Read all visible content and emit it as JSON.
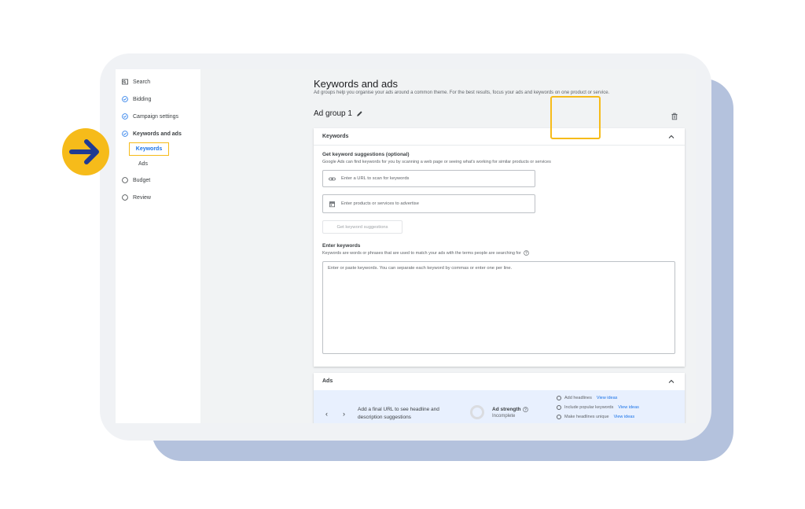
{
  "sidebar": {
    "items": [
      {
        "label": "Search",
        "icon": "search-box-icon"
      },
      {
        "label": "Bidding",
        "icon": "check-circle-icon"
      },
      {
        "label": "Campaign settings",
        "icon": "check-circle-icon"
      },
      {
        "label": "Keywords and ads",
        "icon": "check-circle-icon"
      },
      {
        "label": "Budget",
        "icon": "empty-circle-icon"
      },
      {
        "label": "Review",
        "icon": "empty-circle-icon"
      }
    ],
    "sub_items": [
      {
        "label": "Keywords",
        "active": true
      },
      {
        "label": "Ads",
        "active": false
      }
    ]
  },
  "main": {
    "title": "Keywords and ads",
    "description": "Ad groups help you organise your ads around a common theme. For the best results, focus your ads and keywords on one product or service.",
    "ad_group_name": "Ad group 1"
  },
  "keywords_panel": {
    "header": "Keywords",
    "suggestions_title": "Get keyword suggestions (optional)",
    "suggestions_desc": "Google Ads can find keywords for you by scanning a web page or seeing what's working for similar products or services",
    "url_placeholder": "Enter a URL to scan for keywords",
    "products_placeholder": "Enter products or services to advertise",
    "get_suggestions_button": "Get keyword suggestions",
    "enter_title": "Enter keywords",
    "enter_desc": "Keywords are words or phrases that are used to match your ads with the terms people are searching for",
    "textarea_placeholder": "Enter or paste keywords. You can separate each keyword by commas or enter one per line."
  },
  "ads_panel": {
    "header": "Ads",
    "suggestion_text": "Add a final URL to see headline and description suggestions",
    "strength_label": "Ad strength",
    "strength_status": "Incomplete",
    "checklist": [
      {
        "label": "Add headlines",
        "link": "View ideas"
      },
      {
        "label": "Include popular keywords",
        "link": "View ideas"
      },
      {
        "label": "Make headlines unique",
        "link": "View ideas"
      }
    ]
  },
  "colors": {
    "accent": "#1a73e8",
    "highlight": "#f6bb1a",
    "arrow": "#1f3a93"
  }
}
